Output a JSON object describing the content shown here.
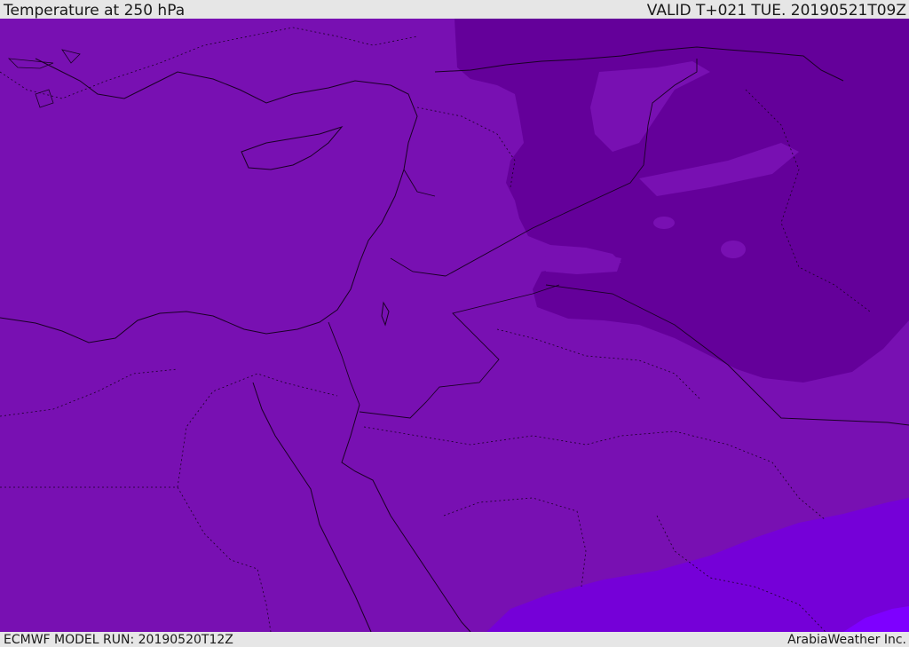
{
  "header": {
    "title": "Temperature at 250 hPa",
    "valid_time": "VALID T+021 TUE. 20190521T09Z"
  },
  "footer": {
    "model_run": "ECMWF MODEL RUN: 20190520T12Z",
    "credit": "ArabiaWeather Inc."
  },
  "map": {
    "colors": {
      "base": "#7810b2",
      "cold": "#64009a",
      "warm": "#7500d8",
      "warmest": "#7e00ff",
      "coast": "#1a0025"
    }
  }
}
